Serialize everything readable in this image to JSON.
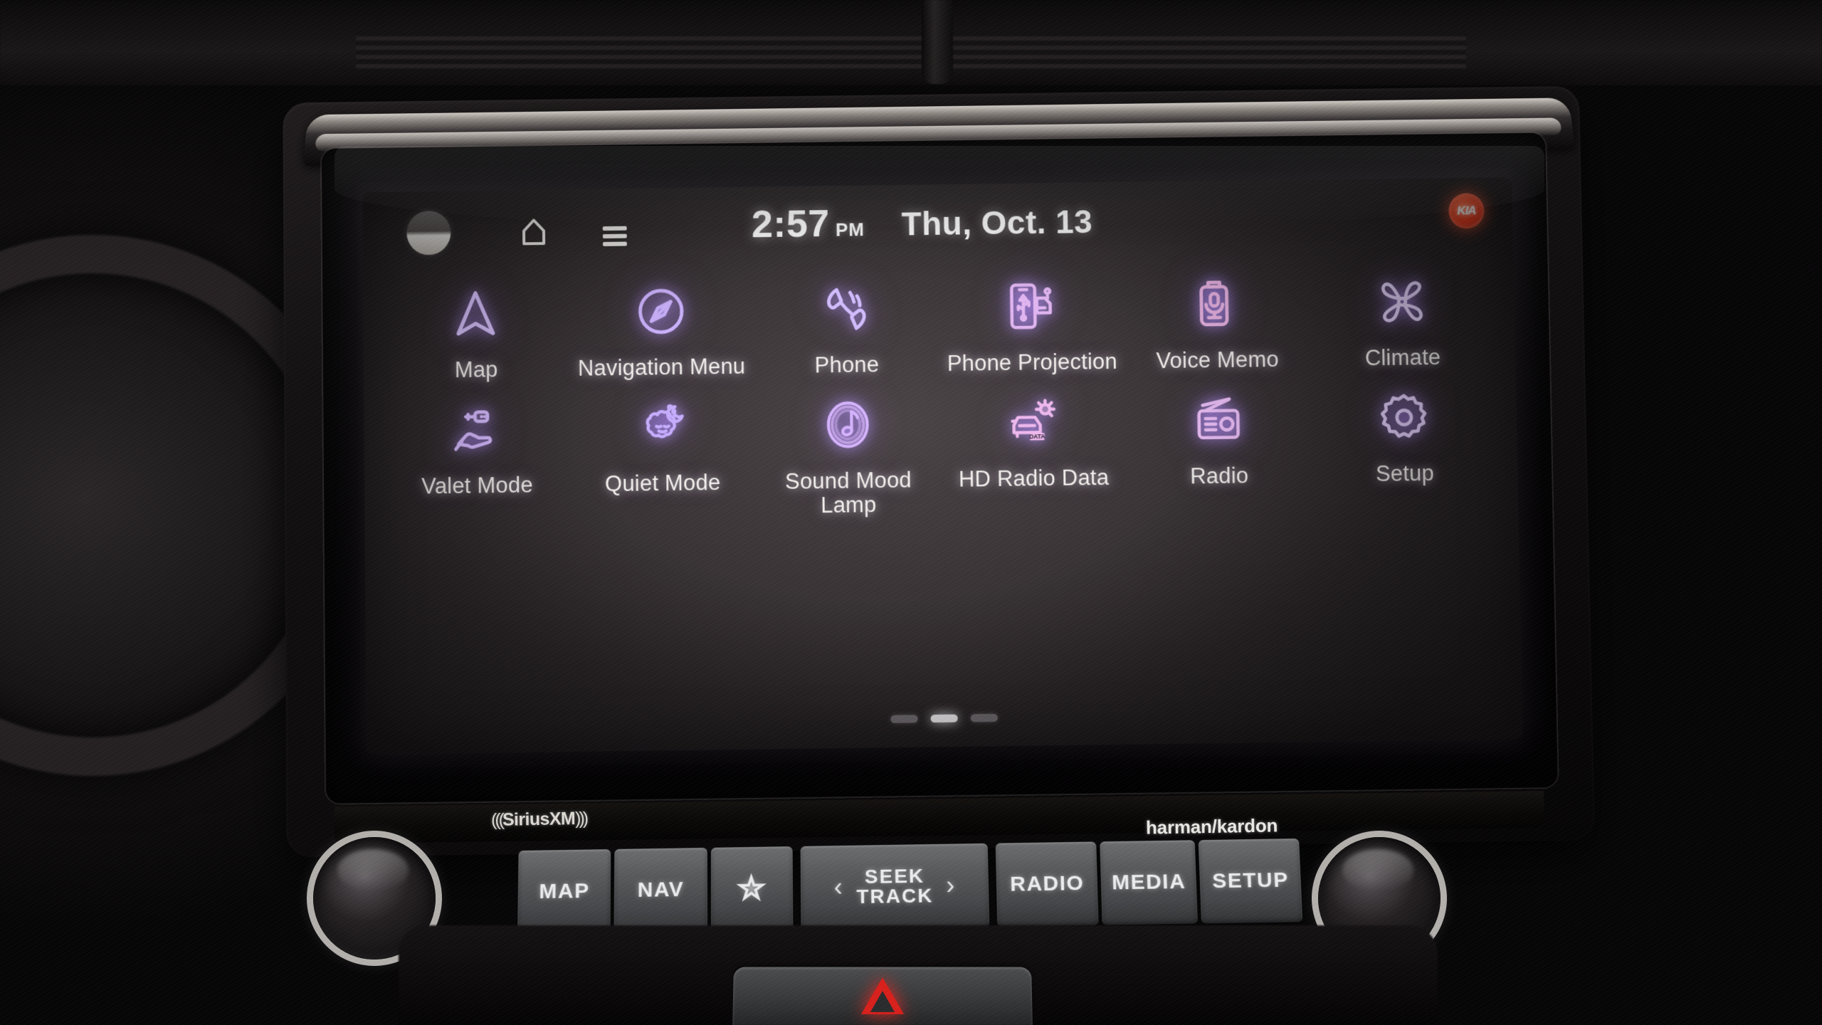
{
  "screen": {
    "status_bar": {
      "avatar": "user-avatar",
      "home_icon": "home-icon",
      "menu_icon": "menu-icon",
      "time": "2:57",
      "ampm": "PM",
      "date": "Thu, Oct. 13",
      "brand_badge": "KIA",
      "badge_color": "#e4361c"
    },
    "apps_row1": [
      {
        "label": "Map",
        "icon": "navigation-arrow-icon"
      },
      {
        "label": "Navigation Menu",
        "icon": "compass-icon"
      },
      {
        "label": "Phone",
        "icon": "phone-handset-icon"
      },
      {
        "label": "Phone Projection",
        "icon": "phone-usb-car-icon"
      },
      {
        "label": "Voice Memo",
        "icon": "voice-recorder-icon"
      },
      {
        "label": "Climate",
        "icon": "fan-blade-icon"
      }
    ],
    "apps_row2": [
      {
        "label": "Valet Mode",
        "icon": "hand-key-icon"
      },
      {
        "label": "Quiet Mode",
        "icon": "sleeping-face-moon-icon"
      },
      {
        "label": "Sound Mood Lamp",
        "icon": "music-note-circle-icon"
      },
      {
        "label": "HD Radio Data",
        "icon": "car-data-signal-icon"
      },
      {
        "label": "Radio",
        "icon": "radio-antenna-icon"
      },
      {
        "label": "Setup",
        "icon": "gear-icon"
      }
    ],
    "pagination": {
      "total": 3,
      "active_index": 1
    },
    "accent_color": "#c9a6ff",
    "text_color": "#f4f1ef"
  },
  "bezel": {
    "left_brand": "SiriusXM",
    "right_brand": "harman/kardon"
  },
  "hard_buttons": {
    "map": "MAP",
    "nav": "NAV",
    "favorite": "favorite-star",
    "seek_prev": "‹",
    "seek_line1": "SEEK",
    "seek_line2": "TRACK",
    "seek_next": "›",
    "radio": "RADIO",
    "media": "MEDIA",
    "setup": "SETUP"
  },
  "knobs": {
    "left": "volume-power-knob",
    "right": "tune-knob"
  },
  "hazard": "hazard-lights-button"
}
